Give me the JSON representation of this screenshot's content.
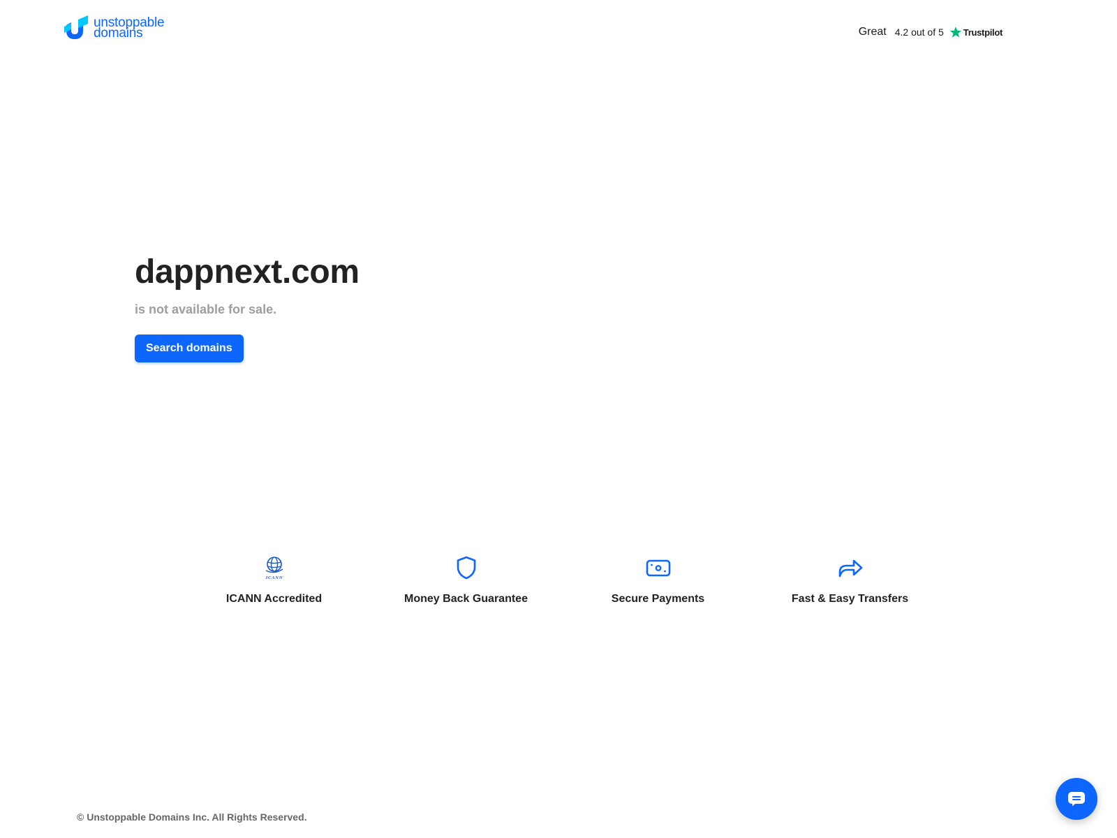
{
  "header": {
    "logo": {
      "line1": "unstoppable",
      "line2": "domains",
      "icon": "unstoppable-domains-logo-icon"
    },
    "trustpilot": {
      "rating_word": "Great",
      "score_text": "4.2 out of 5",
      "brand": "Trustpilot",
      "star_icon": "star-icon",
      "star_color": "#00b67a"
    }
  },
  "hero": {
    "domain": "dappnext.com",
    "status": "is not available for sale.",
    "search_button_label": "Search domains"
  },
  "features": [
    {
      "label": "ICANN Accredited",
      "icon": "icann-globe-icon"
    },
    {
      "label": "Money Back Guarantee",
      "icon": "shield-icon"
    },
    {
      "label": "Secure Payments",
      "icon": "banknote-icon"
    },
    {
      "label": "Fast & Easy Transfers",
      "icon": "share-arrow-icon"
    }
  ],
  "footer": {
    "copyright": "© Unstoppable Domains Inc. All Rights Reserved."
  },
  "chat": {
    "icon": "chat-bubble-icon"
  },
  "colors": {
    "accent": "#0d67fe",
    "heading": "#222222",
    "muted": "#9e9e9e",
    "footer_text": "#666666"
  }
}
